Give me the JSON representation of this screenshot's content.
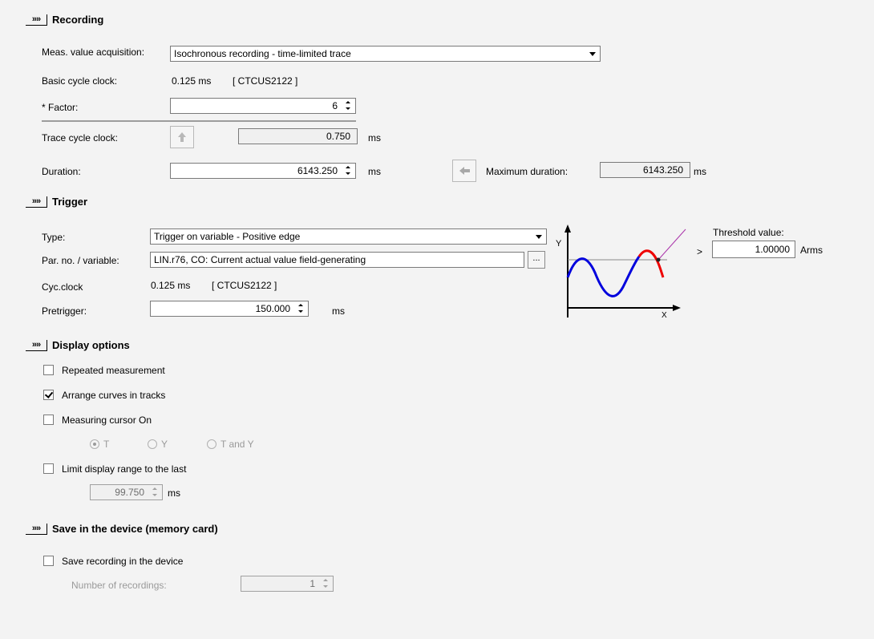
{
  "recording": {
    "header_btn": "»»",
    "title": "Recording",
    "acq_label": "Meas. value acquisition:",
    "acq_value": "Isochronous recording - time-limited trace",
    "basic_label": "Basic cycle clock:",
    "basic_value": "0.125 ms",
    "basic_device": "[ CTCUS2122 ]",
    "factor_label": "* Factor:",
    "factor_value": "6",
    "trace_label": "Trace cycle clock:",
    "trace_value": "0.750",
    "trace_unit": "ms",
    "duration_label": "Duration:",
    "duration_value": "6143.250",
    "duration_unit": "ms",
    "maxdur_label": "Maximum duration:",
    "maxdur_value": "6143.250",
    "maxdur_unit": "ms"
  },
  "trigger": {
    "header_btn": "»»",
    "title": "Trigger",
    "type_label": "Type:",
    "type_value": "Trigger on variable - Positive edge",
    "par_label": "Par. no. / variable:",
    "par_value": "LIN.r76, CO: Current actual value field-generating",
    "par_button": "...",
    "cyc_label": "Cyc.clock",
    "cyc_value": "0.125 ms",
    "cyc_device": "[ CTCUS2122 ]",
    "pre_label": "Pretrigger:",
    "pre_value": "150.000",
    "pre_unit": "ms",
    "graph_y": "Y",
    "graph_x": "X",
    "gt_symbol": ">",
    "threshold_label": "Threshold value:",
    "threshold_value": "1.00000",
    "threshold_unit": "Arms"
  },
  "display": {
    "header_btn": "»»",
    "title": "Display options",
    "repeated": {
      "label": "Repeated measurement",
      "checked": false
    },
    "arrange": {
      "label": "Arrange curves in tracks",
      "checked": true
    },
    "cursor": {
      "label": "Measuring cursor On",
      "checked": false
    },
    "radio_t": "T",
    "radio_y": "Y",
    "radio_ty": "T and Y",
    "limit": {
      "label": "Limit display range to the last",
      "checked": false
    },
    "limit_value": "99.750",
    "limit_unit": "ms"
  },
  "save": {
    "header_btn": "»»",
    "title": "Save in the device (memory card)",
    "save_rec": {
      "label": "Save recording in the device",
      "checked": false
    },
    "num_label": "Number of recordings:",
    "num_value": "1"
  }
}
